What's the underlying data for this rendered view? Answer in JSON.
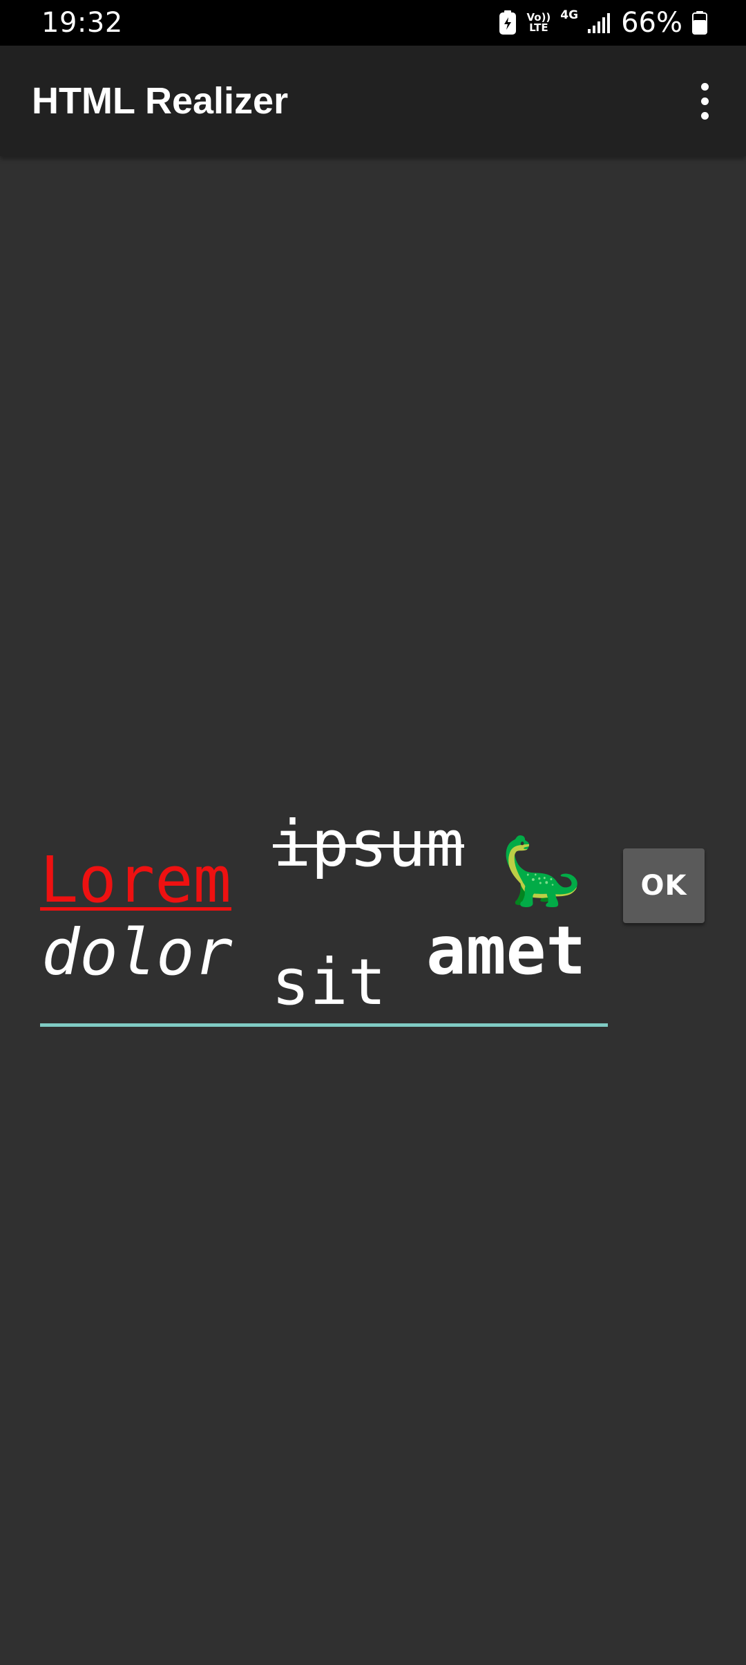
{
  "status_bar": {
    "time": "19:32",
    "volte_top": "Vo))",
    "volte_bottom": "LTE",
    "network": "4G",
    "battery_percent": "66%",
    "icons": [
      "battery-saver-icon",
      "volte-icon",
      "signal-icon",
      "battery-icon"
    ]
  },
  "app_bar": {
    "title": "HTML Realizer",
    "menu_icon": "more-vert-icon"
  },
  "editor": {
    "words": {
      "lorem": "Lorem",
      "ipsum": "ipsum",
      "dolor": "dolor",
      "sit": "sit",
      "amet": "amet"
    },
    "emoji": "🦕",
    "underline_color": "#80cbc4",
    "lorem_color": "#ee1111"
  },
  "ok_button": {
    "label": "OK"
  },
  "colors": {
    "background": "#303030",
    "app_bar": "#212121",
    "status_bar": "#000000",
    "button": "#5a5a5a"
  }
}
